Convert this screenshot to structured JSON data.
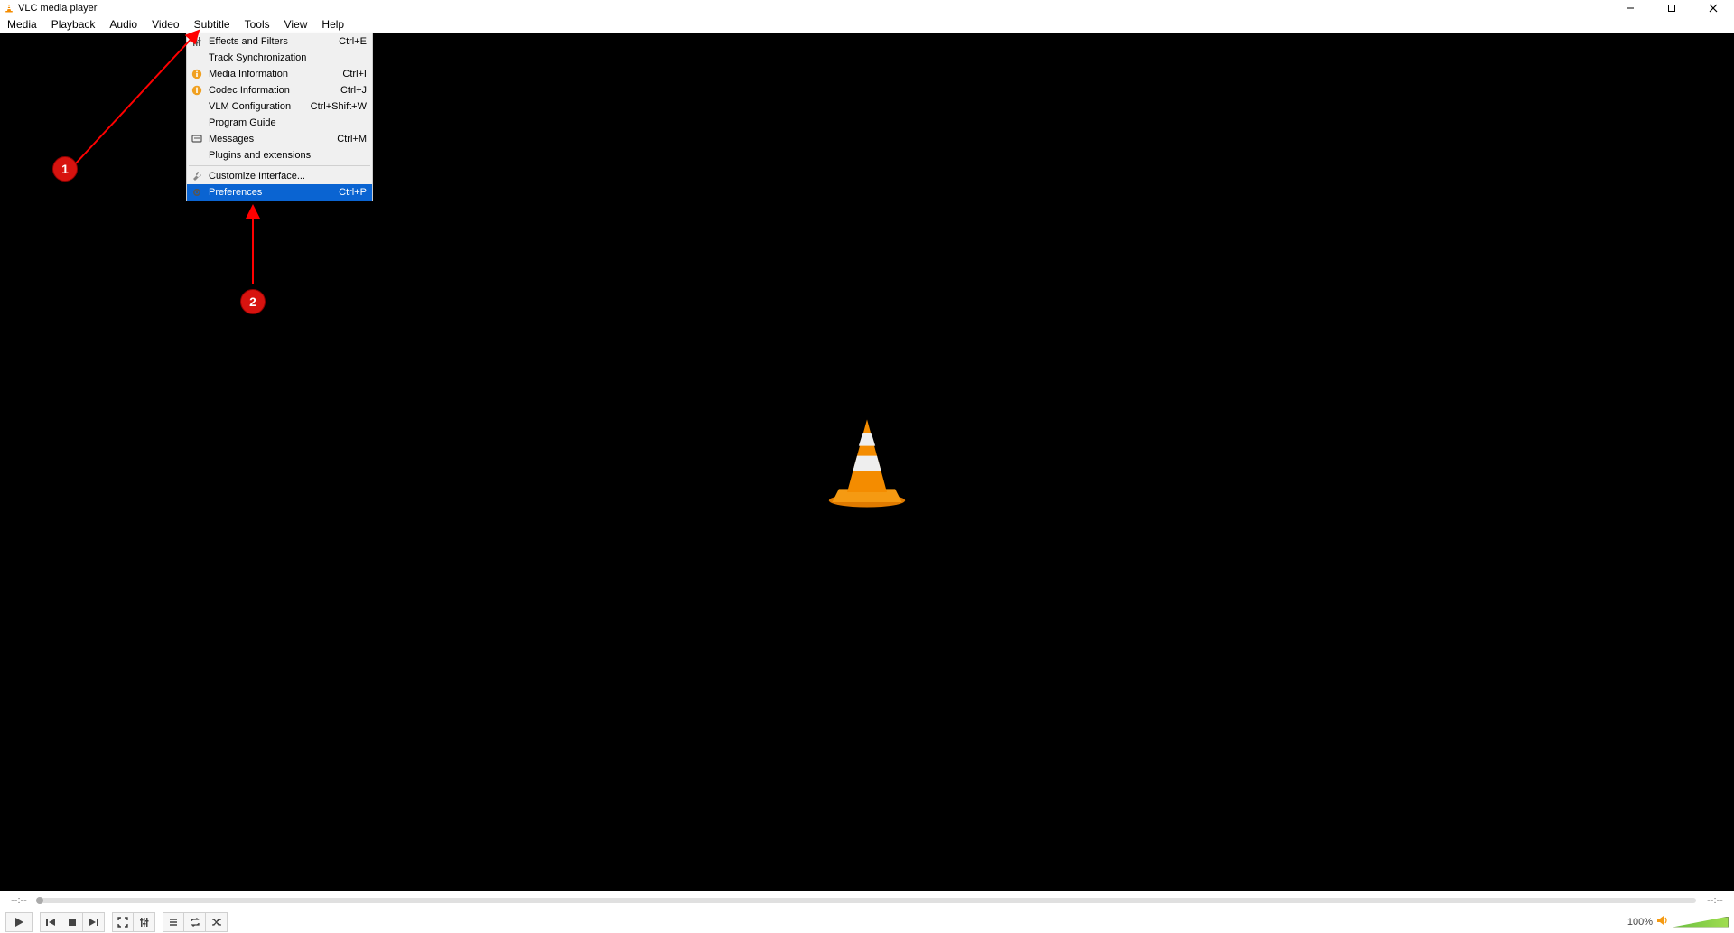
{
  "window": {
    "title": "VLC media player"
  },
  "menubar": [
    "Media",
    "Playback",
    "Audio",
    "Video",
    "Subtitle",
    "Tools",
    "View",
    "Help"
  ],
  "tools_menu": [
    {
      "kind": "item",
      "icon": "sliders-icon",
      "label": "Effects and Filters",
      "accel": "Ctrl+E"
    },
    {
      "kind": "item",
      "icon": "",
      "label": "Track Synchronization",
      "accel": ""
    },
    {
      "kind": "item",
      "icon": "info-icon",
      "label": "Media Information",
      "accel": "Ctrl+I"
    },
    {
      "kind": "item",
      "icon": "info-icon",
      "label": "Codec Information",
      "accel": "Ctrl+J"
    },
    {
      "kind": "item",
      "icon": "",
      "label": "VLM Configuration",
      "accel": "Ctrl+Shift+W"
    },
    {
      "kind": "item",
      "icon": "",
      "label": "Program Guide",
      "accel": ""
    },
    {
      "kind": "item",
      "icon": "message-icon",
      "label": "Messages",
      "accel": "Ctrl+M"
    },
    {
      "kind": "item",
      "icon": "",
      "label": "Plugins and extensions",
      "accel": ""
    },
    {
      "kind": "sep"
    },
    {
      "kind": "item",
      "icon": "wrench-icon",
      "label": "Customize Interface...",
      "accel": ""
    },
    {
      "kind": "item",
      "icon": "gear-icon",
      "label": "Preferences",
      "accel": "Ctrl+P",
      "highlight": true
    }
  ],
  "annotations": {
    "badge1_label": "1",
    "badge2_label": "2"
  },
  "playback": {
    "time_elapsed": "--:--",
    "time_total": "--:--",
    "volume_text": "100%"
  }
}
